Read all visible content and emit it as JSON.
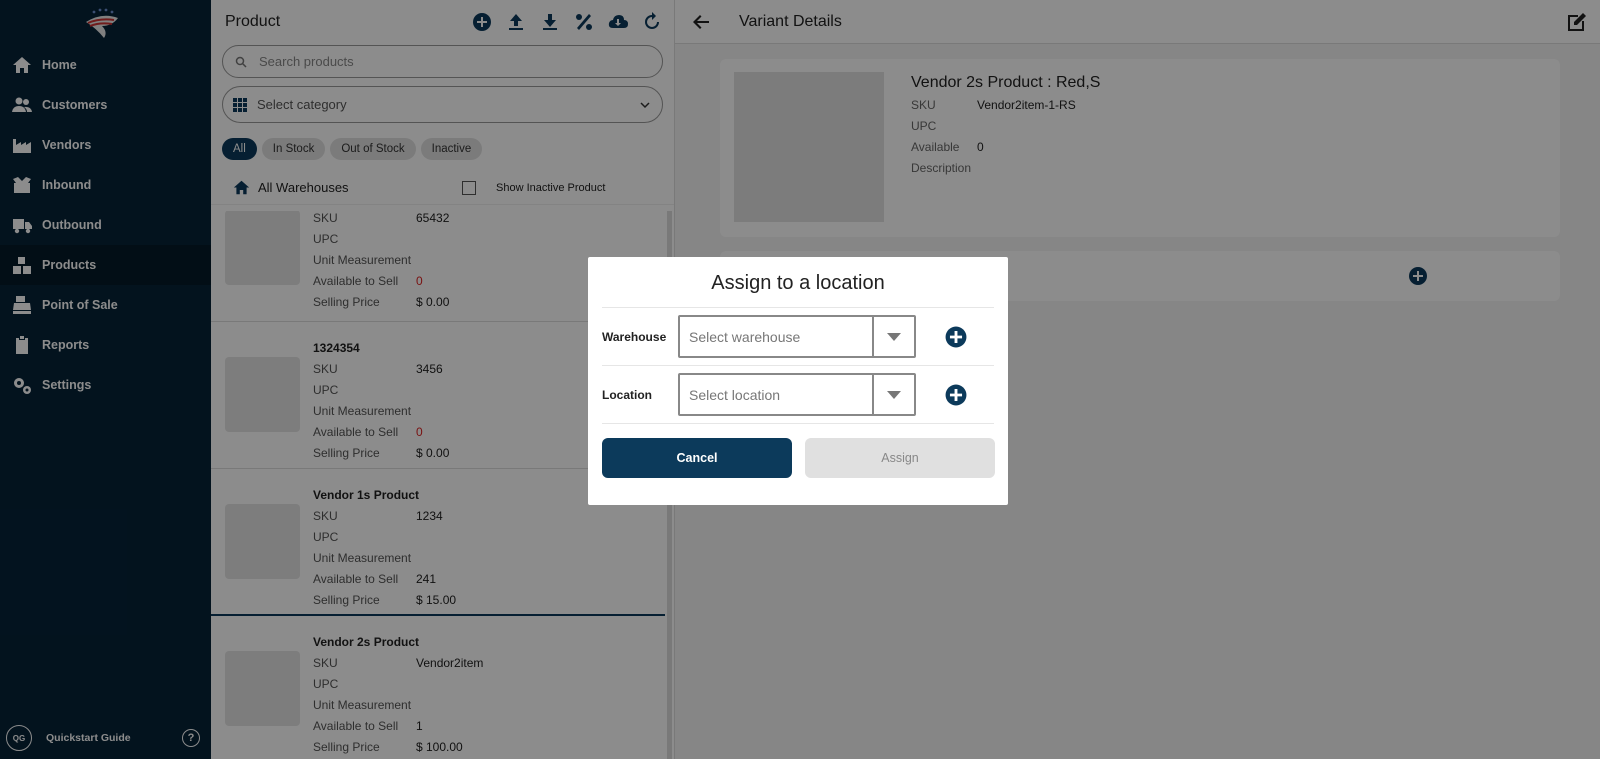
{
  "sidebar": {
    "items": [
      {
        "label": "Home",
        "icon": "home-icon"
      },
      {
        "label": "Customers",
        "icon": "users-icon"
      },
      {
        "label": "Vendors",
        "icon": "factory-icon"
      },
      {
        "label": "Inbound",
        "icon": "box-open-icon"
      },
      {
        "label": "Outbound",
        "icon": "truck-icon"
      },
      {
        "label": "Products",
        "icon": "boxes-icon",
        "active": true
      },
      {
        "label": "Point of Sale",
        "icon": "cash-register-icon"
      },
      {
        "label": "Reports",
        "icon": "clipboard-icon"
      },
      {
        "label": "Settings",
        "icon": "gears-icon"
      }
    ],
    "footer": {
      "badge": "QG",
      "label": "Quickstart Guide",
      "help": "?"
    }
  },
  "product_panel": {
    "title": "Product",
    "search_placeholder": "Search products",
    "category_placeholder": "Select category",
    "filters": [
      "All",
      "In Stock",
      "Out of Stock",
      "Inactive"
    ],
    "warehouse_label": "All Warehouses",
    "show_inactive_label": "Show Inactive Product",
    "field_labels": {
      "sku": "SKU",
      "upc": "UPC",
      "unit": "Unit Measurement",
      "available": "Available to Sell",
      "price": "Selling Price"
    },
    "products": [
      {
        "name": "",
        "sku": "65432",
        "upc": "",
        "unit": "",
        "available": "0",
        "price": "$ 0.00"
      },
      {
        "name": "1324354",
        "sku": "3456",
        "upc": "",
        "unit": "",
        "available": "0",
        "price": "$ 0.00"
      },
      {
        "name": "Vendor 1s Product",
        "sku": "1234",
        "upc": "",
        "unit": "",
        "available": "241",
        "price": "$ 15.00"
      },
      {
        "name": "Vendor 2s Product",
        "sku": "Vendor2item",
        "upc": "",
        "unit": "",
        "available": "1",
        "price": "$ 100.00"
      }
    ]
  },
  "variant": {
    "header": "Variant Details",
    "title": "Vendor 2s Product : Red,S",
    "labels": {
      "sku": "SKU",
      "upc": "UPC",
      "available": "Available",
      "description": "Description"
    },
    "sku": "Vendor2item-1-RS",
    "upc": "",
    "available": "0",
    "description": ""
  },
  "modal": {
    "title": "Assign to a location",
    "warehouse_label": "Warehouse",
    "warehouse_placeholder": "Select warehouse",
    "location_label": "Location",
    "location_placeholder": "Select location",
    "cancel": "Cancel",
    "assign": "Assign"
  },
  "colors": {
    "brand": "#0c3a5b",
    "sidebar": "#062338",
    "alert": "#dd2222"
  }
}
